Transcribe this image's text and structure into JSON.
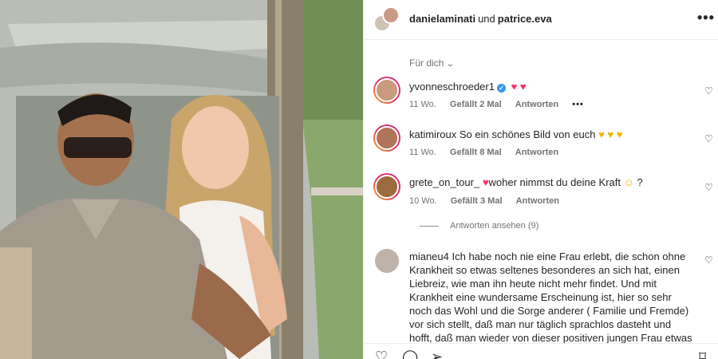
{
  "header": {
    "user1": "danielaminati",
    "joiner": "und",
    "user2": "patrice.eva",
    "more_label": "•••"
  },
  "filter": {
    "label": "Für dich"
  },
  "comments": [
    {
      "user": "yvonneschroeder1",
      "verified": true,
      "text": "",
      "emoji": "♥ ♥",
      "time": "11 Wo.",
      "likes": "Gefällt 2 Mal",
      "reply": "Antworten",
      "more": "•••"
    },
    {
      "user": "katimiroux",
      "text": "So ein schönes Bild von euch",
      "emoji": "♥ ♥ ♥",
      "time": "11 Wo.",
      "likes": "Gefällt 8 Mal",
      "reply": "Antworten"
    },
    {
      "user": "grete_on_tour_",
      "text_pre": "♥",
      "text": "woher nimmst du deine Kraft",
      "emoji": "☺",
      "text_post": "?",
      "time": "10 Wo.",
      "likes": "Gefällt 3 Mal",
      "reply": "Antworten"
    }
  ],
  "view_replies": "Antworten ansehen (9)",
  "long_comment": {
    "user": "mianeu4",
    "text": "Ich habe noch nie eine Frau erlebt, die schon ohne Krankheit so etwas seltenes besonderes an sich hat, einen Liebreiz, wie man ihn heute nicht mehr findet. Und mit Krankheit eine wundersame Erscheinung ist, hier so sehr noch das Wohl und die Sorge anderer ( Familie und Fremde) vor sich stellt, daß man nur täglich sprachlos dasteht und hofft, daß man wieder von dieser positiven jungen Frau etwas hört, oder"
  },
  "colors": {
    "verified": "#3897f0",
    "heart": "#ff2e63",
    "yellow_heart": "#f5b400",
    "meta_text": "#737373"
  }
}
